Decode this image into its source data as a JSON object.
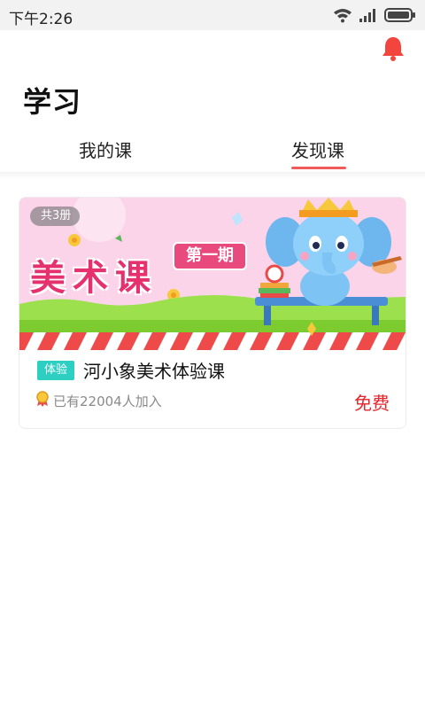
{
  "status_bar": {
    "time": "下午2:26",
    "icons": [
      "wifi-icon",
      "signal-icon",
      "battery-icon"
    ]
  },
  "header": {
    "title": "学习",
    "bell_icon": "bell-icon",
    "bell_color": "#f2453d"
  },
  "tabs": [
    {
      "label": "我的课",
      "active": false
    },
    {
      "label": "发现课",
      "active": true
    }
  ],
  "colors": {
    "accent": "#f05a5a",
    "price": "#e8232a",
    "trial_badge": "#2ccfc2"
  },
  "course_card": {
    "banner": {
      "count_badge": "共3册",
      "title": "美术课",
      "issue": "第一期"
    },
    "badge": "体验",
    "title": "河小象美术体验课",
    "enroll_text": "已有22004人加入",
    "price": "免费"
  }
}
